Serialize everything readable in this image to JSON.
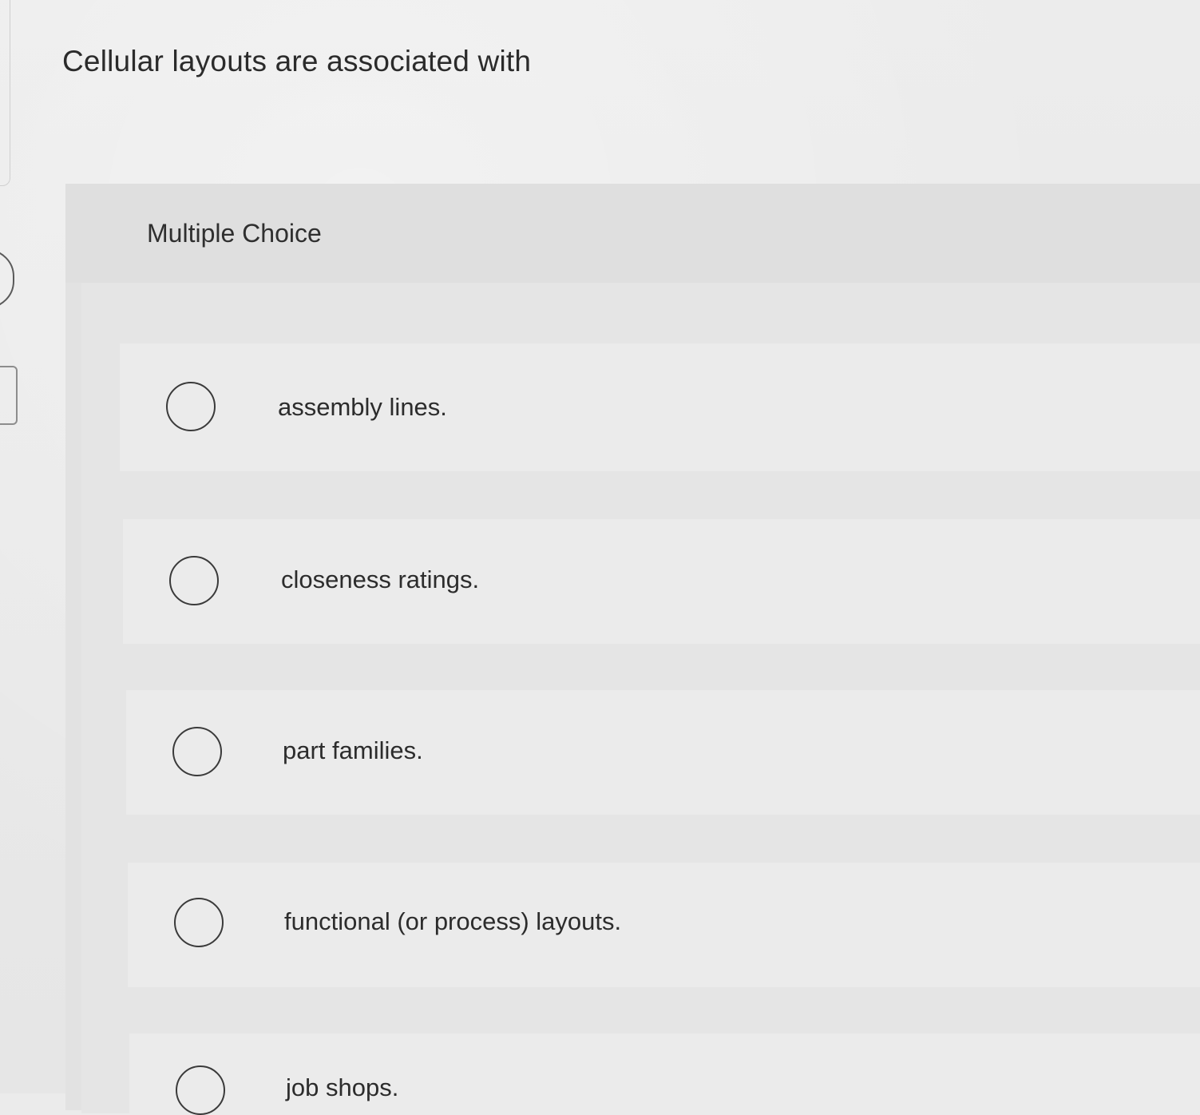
{
  "question": {
    "title": "Cellular layouts are associated with"
  },
  "multiple_choice": {
    "label": "Multiple Choice",
    "options": [
      {
        "label": "assembly lines.",
        "selected": false
      },
      {
        "label": "closeness ratings.",
        "selected": false
      },
      {
        "label": "part families.",
        "selected": false
      },
      {
        "label": "functional (or process) layouts.",
        "selected": false
      },
      {
        "label": "job shops.",
        "selected": false
      }
    ]
  }
}
